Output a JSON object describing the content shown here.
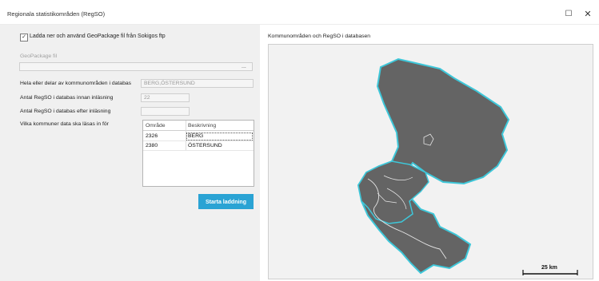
{
  "window": {
    "title": "Regionala statistikområden (RegSO)",
    "maximize_icon": "maximize-icon",
    "close_icon": "close-icon",
    "maximize_glyph": "☐",
    "close_glyph": "✕"
  },
  "form": {
    "checkbox": {
      "checked": true,
      "label": "Ladda ner och använd GeoPackage fil från Sokigos ftp"
    },
    "geopackage_label": "GeoPackage fil",
    "geopackage_value": "",
    "browse_label": "...",
    "kommun_label": "Hela eller delar av kommunområden i databas",
    "kommun_value": "BERG,ÖSTERSUND",
    "before_label": "Antal RegSO i databas innan inläsning",
    "before_value": "22",
    "after_label": "Antal RegSO i databas efter inläsning",
    "after_value": "",
    "grid_label": "Vilka kommuner data ska läsas in för",
    "grid": {
      "columns": [
        "Område",
        "Beskrivning"
      ],
      "rows": [
        [
          "2326",
          "BERG"
        ],
        [
          "2380",
          "ÖSTERSUND"
        ]
      ]
    },
    "start_button": "Starta laddning"
  },
  "map": {
    "title": "Kommunområden och RegSO i databasen",
    "fill_color": "#646464",
    "outline_color": "#3ec7d9",
    "scale_label": "25 km"
  }
}
